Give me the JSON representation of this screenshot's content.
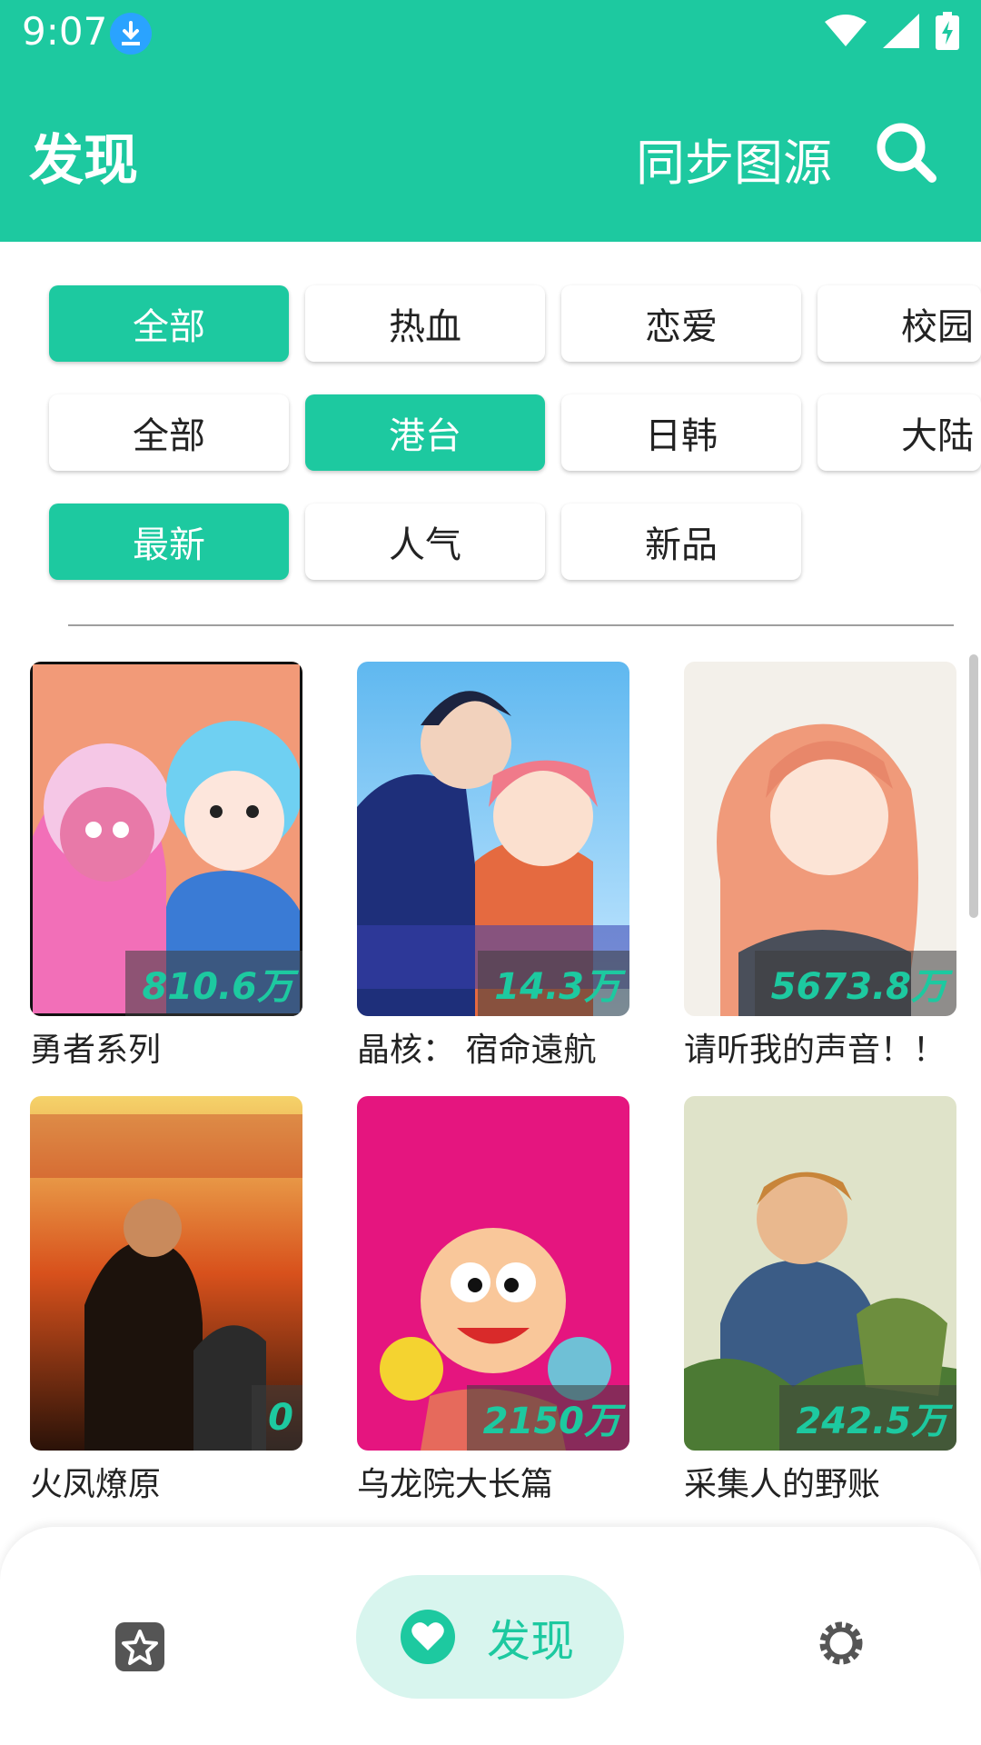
{
  "status_bar": {
    "time": "9:07"
  },
  "app_bar": {
    "title": "发现",
    "sync_label": "同步图源"
  },
  "filters": {
    "genre": [
      "全部",
      "热血",
      "恋爱",
      "校园"
    ],
    "region": [
      "全部",
      "港台",
      "日韩",
      "大陆"
    ],
    "sort": [
      "最新",
      "人气",
      "新品"
    ]
  },
  "comics": [
    {
      "title": "勇者系列",
      "views": "810.6万"
    },
    {
      "title": "晶核： 宿命遠航",
      "views": "14.3万"
    },
    {
      "title": "请听我的声音！！",
      "views": "5673.8万"
    },
    {
      "title": "火凤燎原",
      "views": "0"
    },
    {
      "title": "乌龙院大长篇",
      "views": "2150万"
    },
    {
      "title": "采集人的野账",
      "views": "242.5万"
    }
  ],
  "bottom_nav": {
    "discover_label": "发现"
  },
  "colors": {
    "accent": "#1DC9A0",
    "accent_light": "#D8F5EE"
  }
}
